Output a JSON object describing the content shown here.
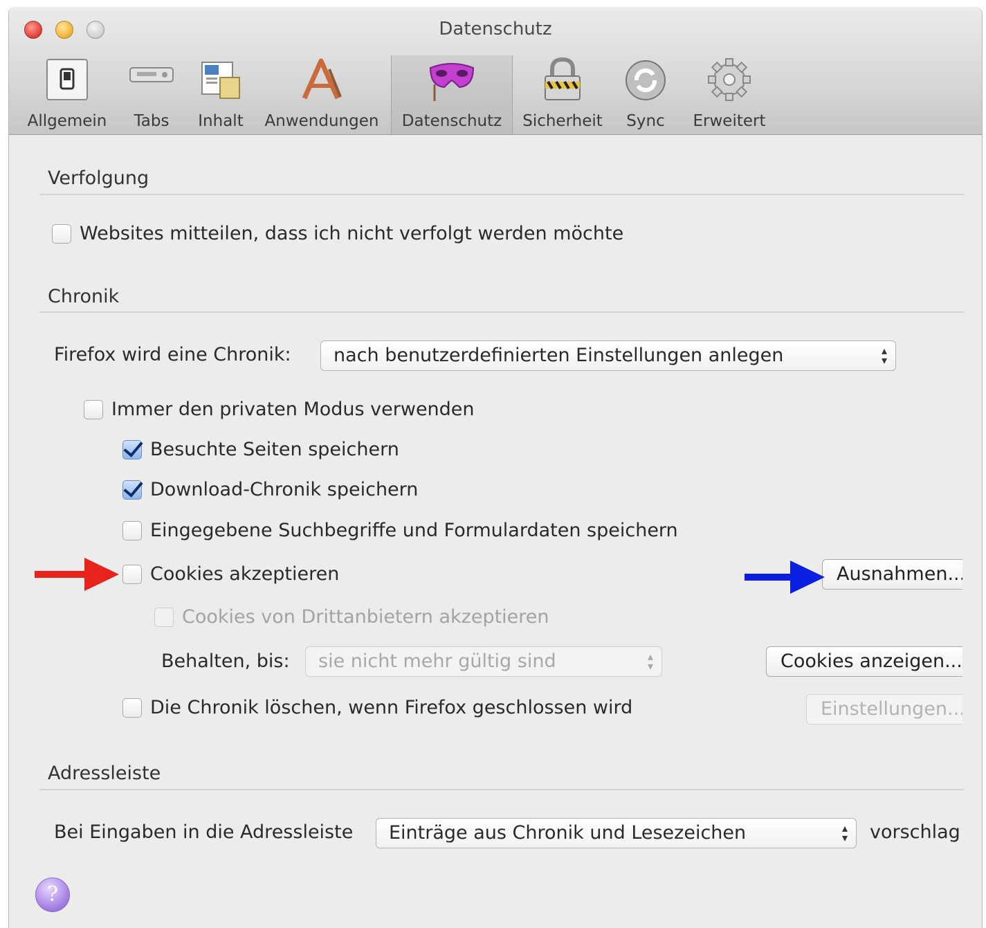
{
  "window": {
    "title": "Datenschutz"
  },
  "toolbar": {
    "items": [
      {
        "label": "Allgemein",
        "icon": "general-switch-icon"
      },
      {
        "label": "Tabs",
        "icon": "tabs-icon"
      },
      {
        "label": "Inhalt",
        "icon": "content-icon"
      },
      {
        "label": "Anwendungen",
        "icon": "applications-icon"
      },
      {
        "label": "Datenschutz",
        "icon": "privacy-mask-icon",
        "selected": true
      },
      {
        "label": "Sicherheit",
        "icon": "padlock-icon"
      },
      {
        "label": "Sync",
        "icon": "sync-icon"
      },
      {
        "label": "Erweitert",
        "icon": "gear-icon"
      }
    ]
  },
  "tracking": {
    "heading": "Verfolgung",
    "do_not_track": {
      "label": "Websites mitteilen, dass ich nicht verfolgt werden möchte",
      "checked": false
    }
  },
  "history": {
    "heading": "Chronik",
    "mode_label": "Firefox wird eine Chronik:",
    "mode_value": "nach benutzerdefinierten Einstellungen anlegen",
    "private_mode": {
      "label": "Immer den privaten Modus verwenden",
      "checked": false
    },
    "visited_pages": {
      "label": "Besuchte Seiten speichern",
      "checked": true
    },
    "download_history": {
      "label": "Download-Chronik speichern",
      "checked": true
    },
    "search_form": {
      "label": "Eingegebene Suchbegriffe und Formulardaten speichern",
      "checked": false
    },
    "accept_cookies": {
      "label": "Cookies akzeptieren",
      "checked": false
    },
    "exceptions_button": "Ausnahmen...",
    "third_party": {
      "label": "Cookies von Drittanbietern akzeptieren",
      "checked": false,
      "disabled": true
    },
    "keep_label": "Behalten, bis:",
    "keep_value": "sie nicht mehr gültig sind",
    "show_cookies_button": "Cookies anzeigen...",
    "clear_on_close": {
      "label": "Die Chronik löschen, wenn Firefox geschlossen wird",
      "checked": false
    },
    "settings_button": "Einstellungen..."
  },
  "address_bar": {
    "heading": "Adressleiste",
    "prefix_label": "Bei Eingaben in die Adressleiste",
    "suggest_value": "Einträge aus Chronik und Lesezeichen",
    "suffix_label": "vorschlag"
  },
  "help": {
    "symbol": "?"
  },
  "annotations": {
    "red_arrow_color": "#e8231b",
    "blue_arrow_color": "#0a1fe0"
  }
}
